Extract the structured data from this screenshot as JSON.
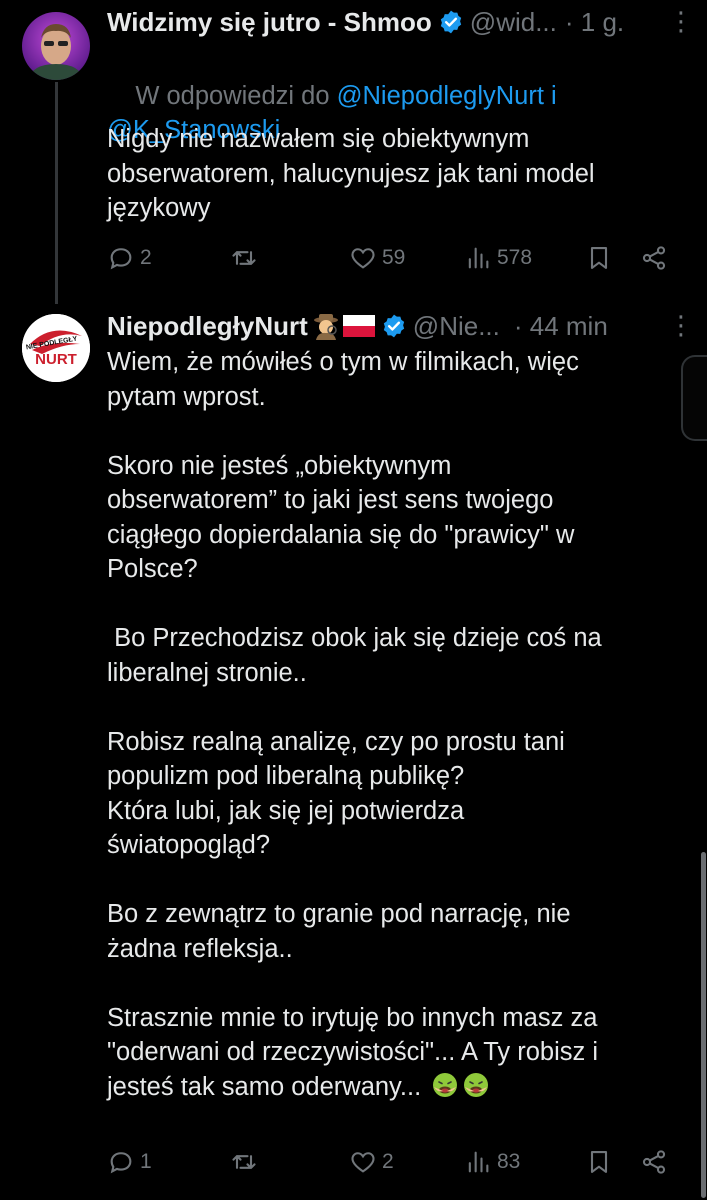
{
  "tweet1": {
    "name": "Widzimy się jutro - Shmoo",
    "handle": "@wid...",
    "time": "· 1 g.",
    "reply_prefix": "W odpowiedzi do ",
    "reply_mention1": "@NiepodleglyNurt",
    "reply_and": " i",
    "reply_mention2": "@K_Stanowski",
    "text": "Nigdy nie nazwałem się obiektywnym\nobserwatorem, halucynujesz jak tani model\njęzykowy",
    "replies": "2",
    "retweets": "",
    "likes": "59",
    "views": "578"
  },
  "tweet2": {
    "name": "NiepodległyNurt",
    "emoji_icons": [
      "detective-emoji",
      "poland-flag"
    ],
    "handle": "@Nie...",
    "time": "· 44 min",
    "text": "Wiem, że mówiłeś o tym w filmikach, więc\npytam wprost.\n\nSkoro nie jesteś „obiektywnym\nobserwatorem” to jaki jest sens twojego\nciągłego dopierdalania się do \"prawicy\" w\nPolsce?\n\n Bo Przechodzisz obok jak się dzieje coś na\nliberalnej stronie..\n\nRobisz realną analizę, czy po prostu tani\npopulizm pod liberalną publikę?\nKtóra lubi, jak się jej potwierdza\nświatopogląd?\n\nBo z zewnątrz to granie pod narrację, nie\nżadna refleksja..\n\nStrasznie mnie to irytuję bo innych masz za\n\"oderwani od rzeczywistości\"... A Ty robisz i\njesteś tak samo oderwany...",
    "trailing_emoji": [
      "nauseated-face-emoji",
      "nauseated-face-emoji"
    ],
    "replies": "1",
    "retweets": "",
    "likes": "2",
    "views": "83"
  },
  "avatar2_logo_top": "NIE PODLEGŁY",
  "avatar2_logo_bottom": "NURT",
  "colors": {
    "background": "#000000",
    "text": "#e7e9ea",
    "muted": "#71767b",
    "link": "#1d9bf0",
    "verified": "#1d9bf0"
  }
}
